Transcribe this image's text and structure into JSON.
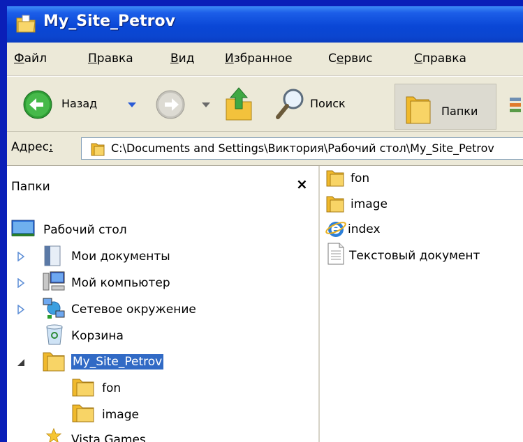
{
  "window": {
    "title": "My_Site_Petrov"
  },
  "menu": {
    "items": [
      {
        "first": "Ф",
        "rest": "айл"
      },
      {
        "first": "П",
        "rest": "равка"
      },
      {
        "first": "В",
        "rest": "ид"
      },
      {
        "first": "И",
        "rest": "збранное"
      },
      {
        "pre": "С",
        "first": "е",
        "rest": "рвис"
      },
      {
        "first": "С",
        "rest": "правка"
      }
    ]
  },
  "toolbar": {
    "back_label": "Назад",
    "search_label": "Поиск",
    "folders_label": "Папки"
  },
  "address": {
    "label_main": "Адрес",
    "label_underlined": ":",
    "path": "C:\\Documents and Settings\\Виктория\\Рабочий стол\\My_Site_Petrov"
  },
  "folders_pane": {
    "title": "Папки",
    "close": "×",
    "tree": [
      {
        "label": "Рабочий стол"
      },
      {
        "label": "Мои документы"
      },
      {
        "label": "Мой компьютер"
      },
      {
        "label": "Сетевое окружение"
      },
      {
        "label": "Корзина"
      },
      {
        "label": "My_Site_Petrov"
      },
      {
        "label": "fon"
      },
      {
        "label": "image"
      },
      {
        "label": "Vista Games"
      }
    ]
  },
  "files": [
    {
      "name": "fon"
    },
    {
      "name": "image"
    },
    {
      "name": "index"
    },
    {
      "name": "Текстовый документ"
    }
  ],
  "colors": {
    "titlebar": "#0a47d6",
    "selection": "#316ac5",
    "frame": "#0a1fb8",
    "chrome": "#ece9d8"
  }
}
